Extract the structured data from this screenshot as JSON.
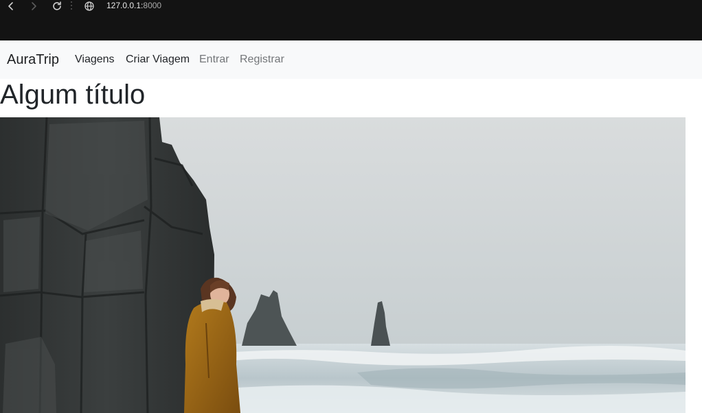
{
  "browser": {
    "url_host": "127.0.0.1:",
    "url_port": "8000",
    "icons": [
      "back-arrow-icon",
      "forward-arrow-icon",
      "reload-icon",
      "site-info-icon"
    ]
  },
  "navbar": {
    "brand": "AuraTrip",
    "links": [
      {
        "label": "Viagens"
      },
      {
        "label": "Criar Viagem"
      },
      {
        "label": "Entrar"
      },
      {
        "label": "Registrar"
      }
    ]
  },
  "main": {
    "title": "Algum título",
    "hero_image": "person-on-rocky-coast-photo"
  },
  "colors": {
    "chrome_bg": "#131313",
    "navbar_bg": "#f8f9fa",
    "text": "#212529",
    "muted_link": "#737679"
  }
}
